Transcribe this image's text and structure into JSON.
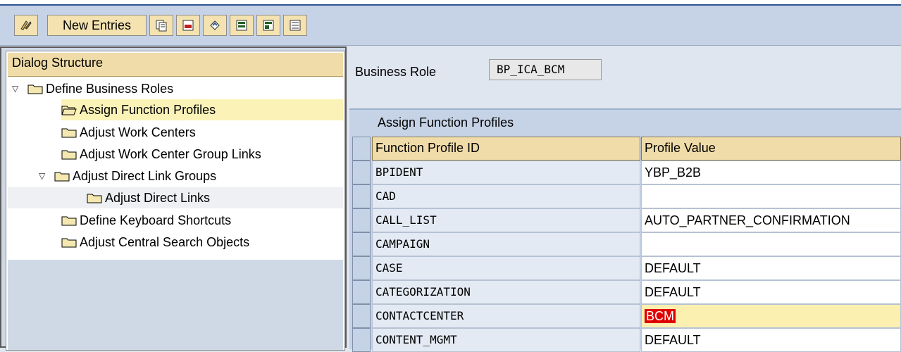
{
  "toolbar": {
    "new_entries_label": "New Entries"
  },
  "dialog_structure": {
    "header": "Dialog Structure",
    "nodes": [
      {
        "label": "Define Business Roles"
      },
      {
        "label": "Assign Function Profiles"
      },
      {
        "label": "Adjust Work Centers"
      },
      {
        "label": "Adjust Work Center Group Links"
      },
      {
        "label": "Adjust Direct Link Groups"
      },
      {
        "label": "Adjust Direct Links"
      },
      {
        "label": "Define Keyboard Shortcuts"
      },
      {
        "label": "Adjust Central Search Objects"
      }
    ]
  },
  "business_role": {
    "label": "Business Role",
    "value": "BP_ICA_BCM"
  },
  "table": {
    "title": "Assign Function Profiles",
    "columns": [
      "Function Profile ID",
      "Profile Value"
    ],
    "rows": [
      {
        "id": "BPIDENT",
        "value": "YBP_B2B"
      },
      {
        "id": "CAD",
        "value": ""
      },
      {
        "id": "CALL_LIST",
        "value": "AUTO_PARTNER_CONFIRMATION"
      },
      {
        "id": "CAMPAIGN",
        "value": ""
      },
      {
        "id": "CASE",
        "value": "DEFAULT"
      },
      {
        "id": "CATEGORIZATION",
        "value": "DEFAULT"
      },
      {
        "id": "CONTACTCENTER",
        "value": "BCM"
      },
      {
        "id": "CONTENT_MGMT",
        "value": "DEFAULT"
      }
    ]
  },
  "colors": {
    "toolbar_bg": "#c6d3e6",
    "header_bg": "#f0dca8",
    "selected_node": "#fbf2b8",
    "error_highlight": "#e00000"
  }
}
